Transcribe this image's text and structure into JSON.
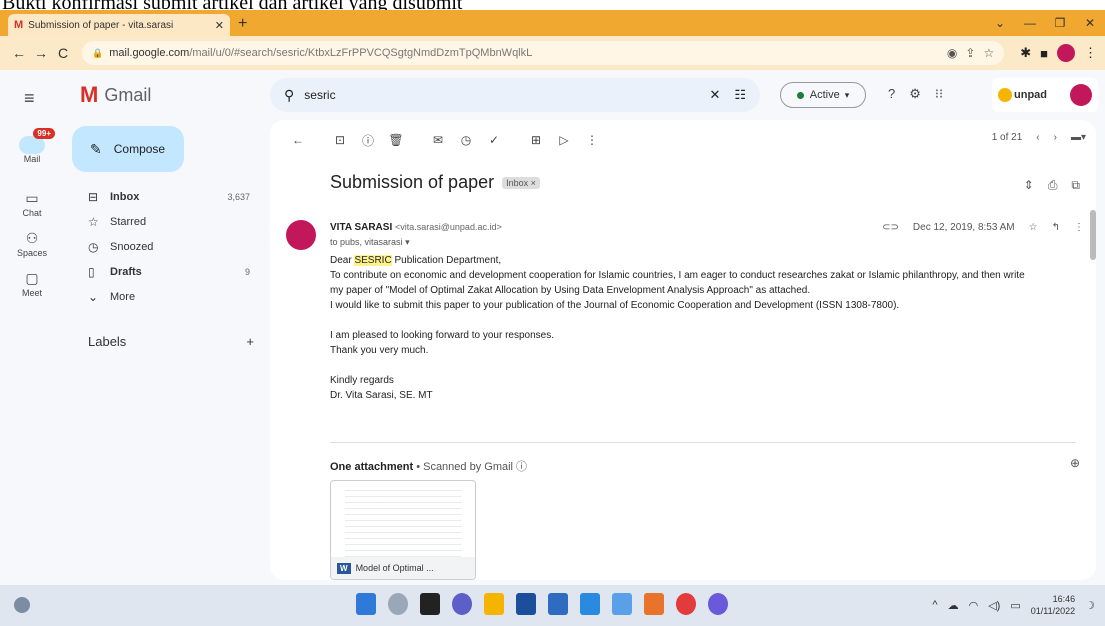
{
  "caption": "Bukti konfirmasi submit artikel dan artikel yang disubmit",
  "browser": {
    "tab_title": "Submission of paper - vita.sarasi",
    "url_host": "mail.google.com",
    "url_path": "/mail/u/0/#search/sesric/KtbxLzFrPPVCQSgtgNmdDzmTpQMbnWqlkL"
  },
  "gmail": {
    "logo_text": "Gmail",
    "compose_label": "Compose",
    "mail_badge": "99+",
    "rail": {
      "mail": "Mail",
      "chat": "Chat",
      "spaces": "Spaces",
      "meet": "Meet"
    },
    "folders": [
      {
        "label": "Inbox",
        "count": "3,637"
      },
      {
        "label": "Starred",
        "count": ""
      },
      {
        "label": "Snoozed",
        "count": ""
      },
      {
        "label": "Drafts",
        "count": "9"
      },
      {
        "label": "More",
        "count": ""
      }
    ],
    "labels_heading": "Labels",
    "search_value": "sesric",
    "status_label": "Active",
    "account_logo": "unpad",
    "pager": "1 of 21"
  },
  "email": {
    "subject": "Submission of paper",
    "chip": "Inbox ×",
    "sender_name": "VITA SARASI",
    "sender_email": "<vita.sarasi@unpad.ac.id>",
    "to": "to pubs, vitasarasi",
    "date": "Dec 12, 2019, 8:53 AM",
    "greeting_pre": "Dear ",
    "greeting_highlight": "SESRIC",
    "greeting_post": " Publication Department,",
    "lines": [
      "To contribute on economic and development cooperation for Islamic countries, I am eager to conduct researches zakat or Islamic philanthropy, and then write",
      "my paper of \"Model of Optimal Zakat Allocation by Using Data Envelopment Analysis Approach\" as attached.",
      "I would like to submit this paper to your publication of the Journal of Economic Cooperation and Development (ISSN 1308-7800)."
    ],
    "lines2": [
      "I am pleased to looking forward to your responses.",
      "Thank you very much."
    ],
    "closing": [
      "Kindly regards",
      "Dr. Vita Sarasi, SE. MT"
    ],
    "attachment_label": "One attachment",
    "attachment_scan": " • Scanned by Gmail ⓘ",
    "attachment_name": "Model of Optimal ...",
    "attachment_type": "W"
  },
  "taskbar": {
    "time": "16:46",
    "date": "01/11/2022"
  }
}
